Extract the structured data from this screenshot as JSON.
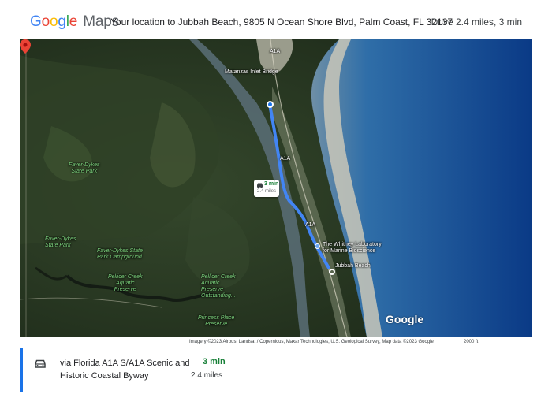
{
  "header": {
    "logo_letters": [
      "G",
      "o",
      "o",
      "g",
      "l",
      "e"
    ],
    "logo_suffix": "Maps",
    "title": "Your location to Jubbah Beach, 9805 N Ocean Shore Blvd, Palm Coast, FL 32137",
    "summary": "Drive 2.4 miles, 3 min"
  },
  "map": {
    "labels": {
      "matanzas_bridge": "Matanzas Inlet Bridge",
      "a1a_north": "A1A",
      "a1a_mid": "A1A",
      "a1a_south": "A1A",
      "faver_dykes_state_park": "Faver-Dykes\nState Park",
      "faver_dykes_state_park_2": "Faver-Dykes\nState Park",
      "faver_dykes_campground": "Faver-Dykes State\nPark Campground",
      "pellicer_creek_1": "Pellicer Creek\nAquatic\nPreserve",
      "pellicer_creek_2": "Pellicer Creek\nAquatic\nPreserve\nOutstanding...",
      "princess_place": "Princess Place\nPreserve",
      "whitney_lab": "The Whitney Laboratory\nfor Marine Bioscience",
      "jubbah_beach": "Jubbah Beach",
      "google_logo": "Google"
    },
    "route_card": {
      "time": "3 min",
      "distance": "2.4 miles"
    },
    "icons": {
      "destination": "red-pin-icon",
      "origin": "blue-dot-icon",
      "car": "car-icon"
    },
    "colors": {
      "route": "#4285F4",
      "ocean": "#0b3f8a",
      "land": "#2b3a24",
      "pin": "#EA4335"
    }
  },
  "footer": {
    "attribution": "Imagery ©2023 Airbus, Landsat / Copernicus, Maxar Technologies, U.S. Geological Survey, Map data ©2023 Google",
    "scale": "2000 ft"
  },
  "route": {
    "via": "via Florida A1A S/A1A Scenic and Historic Coastal Byway",
    "duration": "3 min",
    "distance": "2.4 miles"
  }
}
